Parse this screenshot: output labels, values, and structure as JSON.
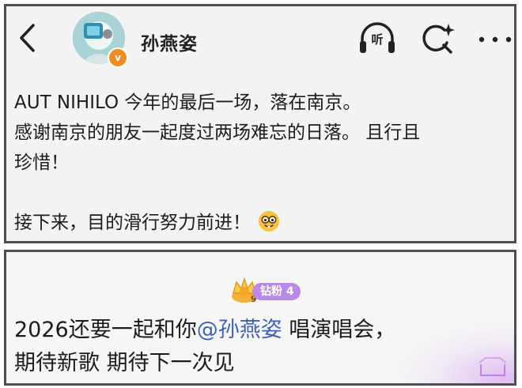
{
  "post": {
    "username": "孙燕姿",
    "verified_mark": "v",
    "listen_label": "听",
    "lines": [
      "AUT NIHILO 今年的最后一场，落在南京。",
      "感谢南京的朋友一起度过两场难忘的日落。 且行且",
      "珍惜！",
      "",
      "接下来，目的滑行努力前进！"
    ],
    "emoji_icon": "nerd-face-emoji-icon"
  },
  "comment": {
    "fan_badge": {
      "crown_number": "9",
      "label": "钻粉",
      "level": "4"
    },
    "line1_prefix": "2026还要一起和你",
    "mention": "@孙燕姿",
    "line1_suffix": " 唱演唱会，",
    "line2": "期待新歌 期待下一次见"
  },
  "colors": {
    "mention": "#3d63b8",
    "fan_pill": "#b98ae8",
    "verified": "#f08c1e",
    "panel_border": "#4f4f4f"
  }
}
